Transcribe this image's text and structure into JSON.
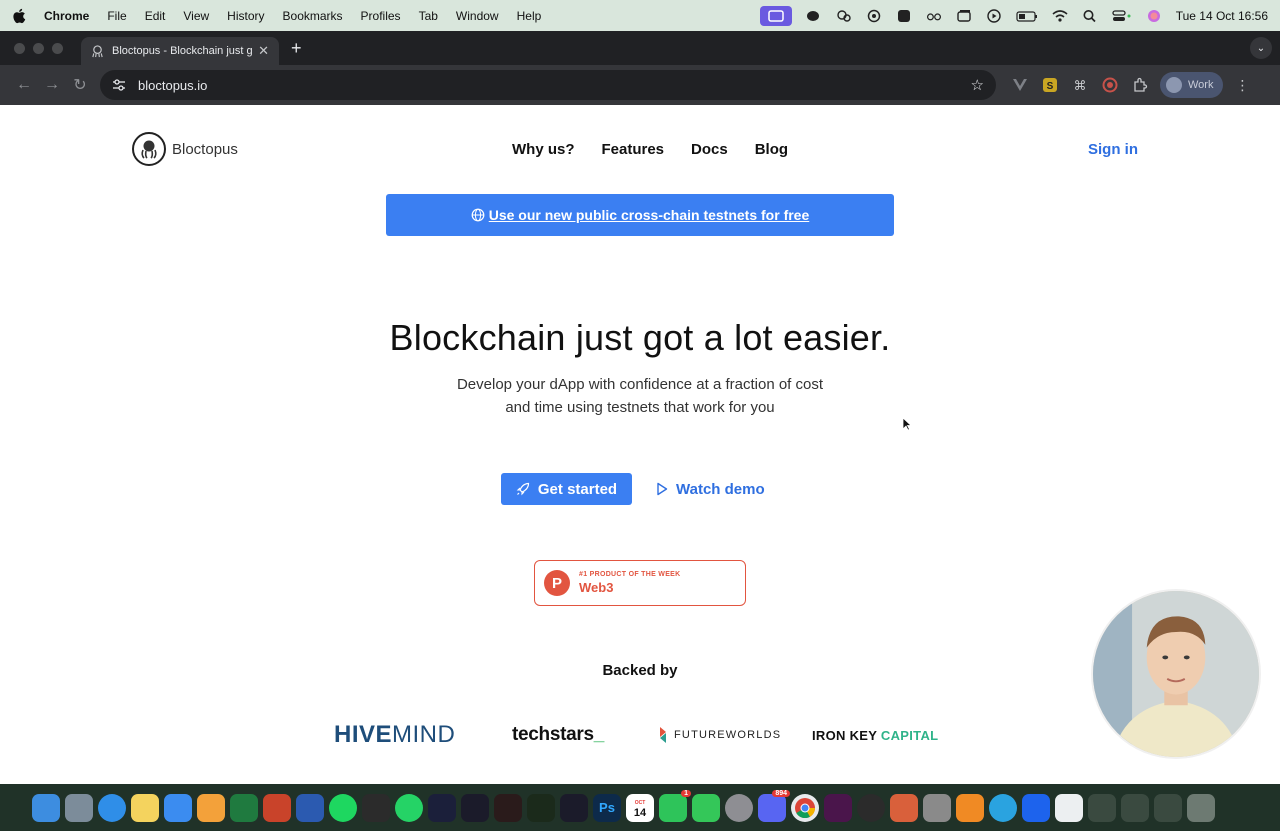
{
  "menubar": {
    "app": "Chrome",
    "items": [
      "File",
      "Edit",
      "View",
      "History",
      "Bookmarks",
      "Profiles",
      "Tab",
      "Window",
      "Help"
    ],
    "clock": "Tue 14 Oct  16:56"
  },
  "browser": {
    "tab_title": "Bloctopus - Blockchain just g",
    "url": "bloctopus.io",
    "profile": "Work"
  },
  "site": {
    "brand": "Bloctopus",
    "nav": [
      "Why us?",
      "Features",
      "Docs",
      "Blog"
    ],
    "signin": "Sign in",
    "banner": "Use our new public cross-chain testnets for free",
    "headline": "Blockchain just got a lot easier.",
    "subline1": "Develop your dApp with confidence at a fraction of cost",
    "subline2": "and time using testnets that work for you",
    "cta_primary": "Get started",
    "cta_secondary": "Watch demo",
    "ph_badge_small": "#1 PRODUCT OF THE WEEK",
    "ph_badge_big": "Web3",
    "ph_letter": "P",
    "backed_by": "Backed by",
    "backers": {
      "hive_a": "HIVE",
      "hive_b": "MIND",
      "techstars": "techstars",
      "techstars_suffix": "_",
      "futureworlds": "FUTUREWORLDS",
      "ironkey_a": "IRON KEY ",
      "ironkey_b": "CAPITAL"
    }
  },
  "dock": {
    "calendar_month": "OCT",
    "calendar_day": "14",
    "facetime_badge": "1",
    "discord_badge": "894"
  },
  "colors": {
    "accent": "#3b7ff2",
    "link": "#2f6fe0",
    "producthunt": "#e25540"
  }
}
